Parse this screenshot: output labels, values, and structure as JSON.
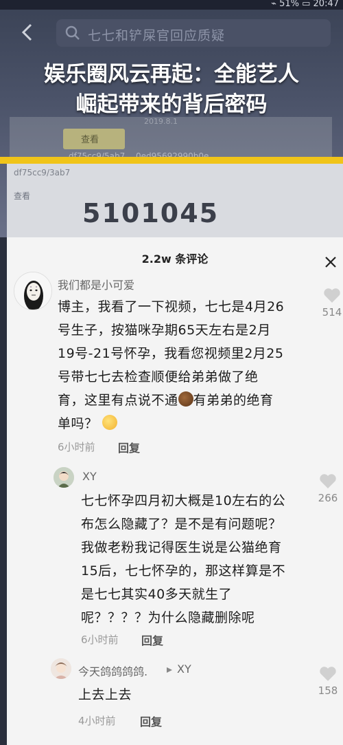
{
  "status_bar": {
    "right_text": "⌁ 51% ▭ 20:47"
  },
  "search": {
    "query": "七七和铲屎官回应质疑"
  },
  "headline": {
    "line1": "娱乐圈风云再起：全能艺人",
    "line2": "崛起带来的背后密码"
  },
  "background_screen": {
    "button_text": "查看",
    "date_text": "2019.8.1",
    "hash1": "df75cc9/5ab7 …0ed95692990b0e",
    "hash2": "df75cc9/3ab7",
    "view_text": "查看",
    "number": "5101045"
  },
  "comments_sheet": {
    "title": "2.2w 条评论",
    "comments": [
      {
        "username": "我们都是小可爱",
        "text_lines": [
          "博主，我看了一下视频，七七是4月26",
          "号生子，按猫咪孕期65天左右是2月",
          "19号-21号怀孕，我看您视频里2月25",
          "号带七七去检查顺便给弟弟做了绝",
          "育，这里有点说不通",
          "有弟弟的绝育",
          "单吗？"
        ],
        "time": "6小时前",
        "reply_label": "回复",
        "likes": "514"
      },
      {
        "username": "XY",
        "text_lines": [
          "七七怀孕四月初大概是10左右的公",
          "布怎么隐藏了？是不是有问题呢？",
          "我做老粉我记得医生说是公猫绝育",
          "15后，七七怀孕的，那这样算是不",
          "是七七其实40多天就生了",
          "呢？？？？为什么隐藏删除呢"
        ],
        "time": "6小时前",
        "reply_label": "回复",
        "likes": "266"
      },
      {
        "username": "今天鸽鸽鸽鸽.",
        "reply_to": "XY",
        "text_lines": [
          "上去上去"
        ],
        "time": "4小时前",
        "reply_label": "回复",
        "likes": "158"
      }
    ]
  },
  "colors": {
    "accent_yellow": "#f0c419",
    "sheet_bg": "#f4f4f4"
  }
}
